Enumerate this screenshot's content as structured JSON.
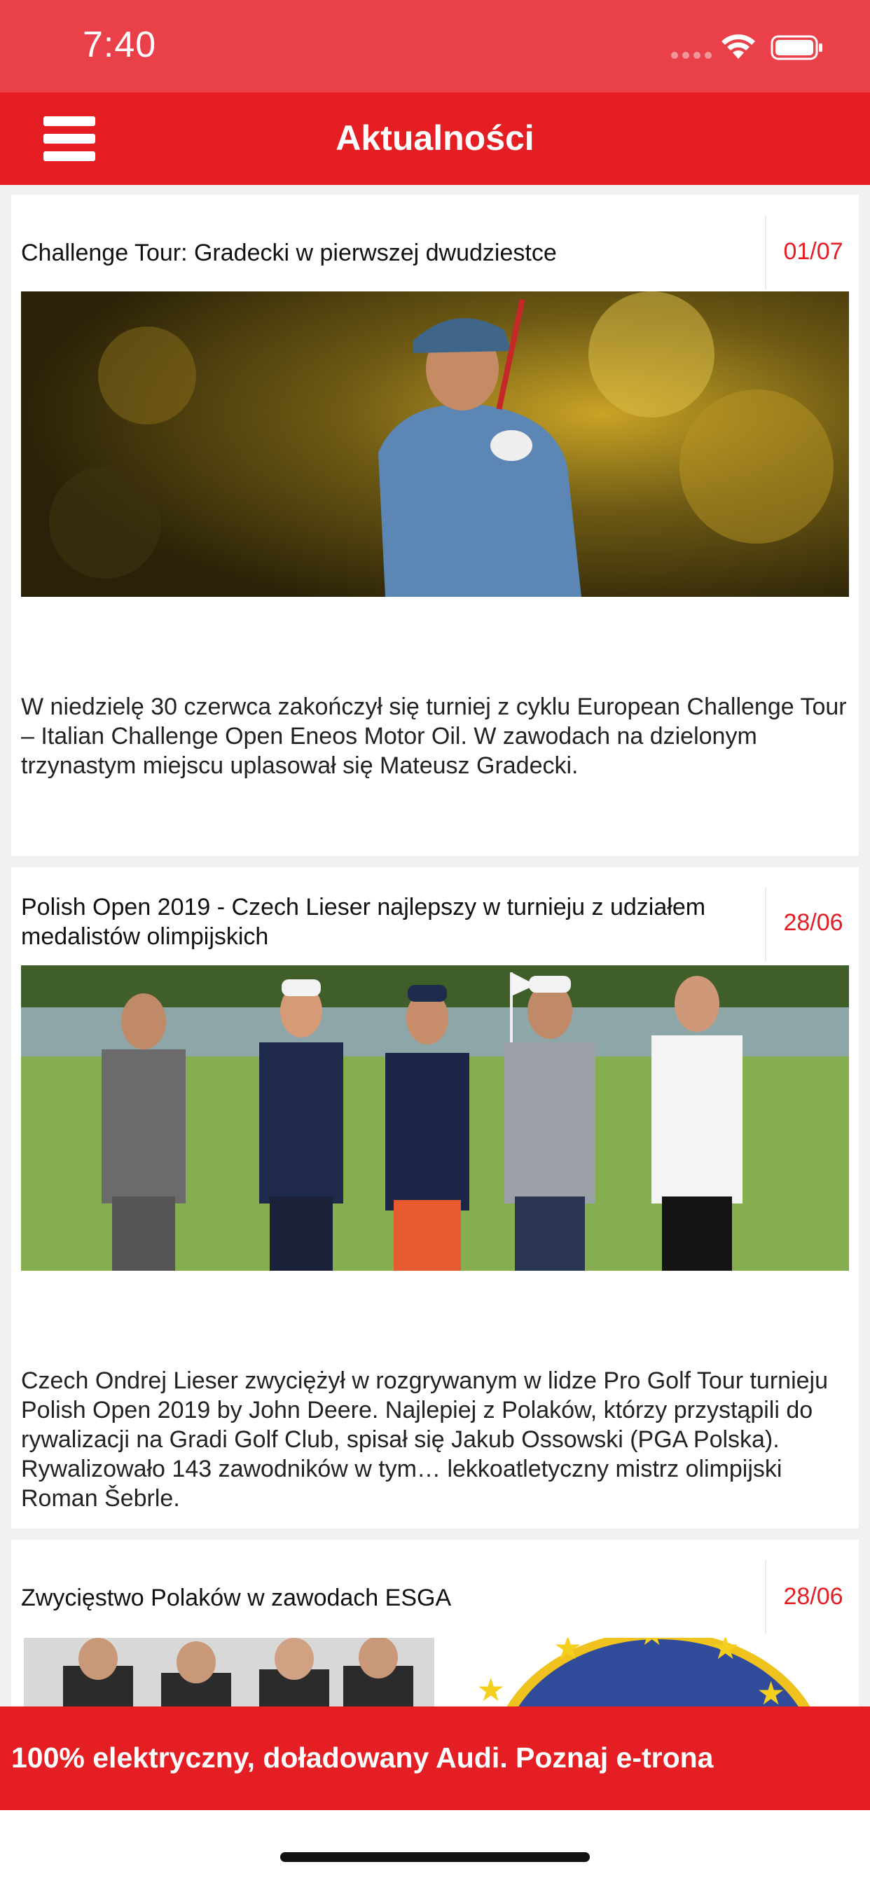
{
  "status_bar": {
    "time": "7:40"
  },
  "nav": {
    "title": "Aktualności",
    "menu_icon": "hamburger-menu-icon"
  },
  "articles": [
    {
      "title": "Challenge Tour: Gradecki w pierwszej dwudziestce",
      "date": "01/07",
      "text": "W niedzielę 30 czerwca zakończył się turniej z cyklu European Challenge Tour – Italian Challenge Open Eneos Motor Oil. W zawodach na dzielonym trzynastym miejscu uplasował się Mateusz Gradecki."
    },
    {
      "title": "Polish Open 2019 - Czech Lieser najlepszy w turnieju z udziałem medalistów olimpijskich",
      "date": "28/06",
      "text": "Czech Ondrej Lieser zwyciężył w rozgrywanym w lidze Pro Golf Tour turnieju Polish Open 2019 by John Deere. Najlepiej z Polaków, którzy przystąpili do rywalizacji na Gradi Golf Club, spisał się Jakub Ossowski (PGA Polska). Rywalizowało 143 zawodników w tym… lekkoatletyczny mistrz olimpijski Roman Šebrle."
    },
    {
      "title": "Zwycięstwo Polaków w zawodach ESGA",
      "date": "28/06"
    }
  ],
  "ad": {
    "text": "100% elektryczny, doładowany Audi. Poznaj e-trona"
  },
  "colors": {
    "status_bar": "#e9404a",
    "nav_bar": "#e41e23",
    "date_text": "#e41e23",
    "ad_banner": "#e41e23"
  }
}
